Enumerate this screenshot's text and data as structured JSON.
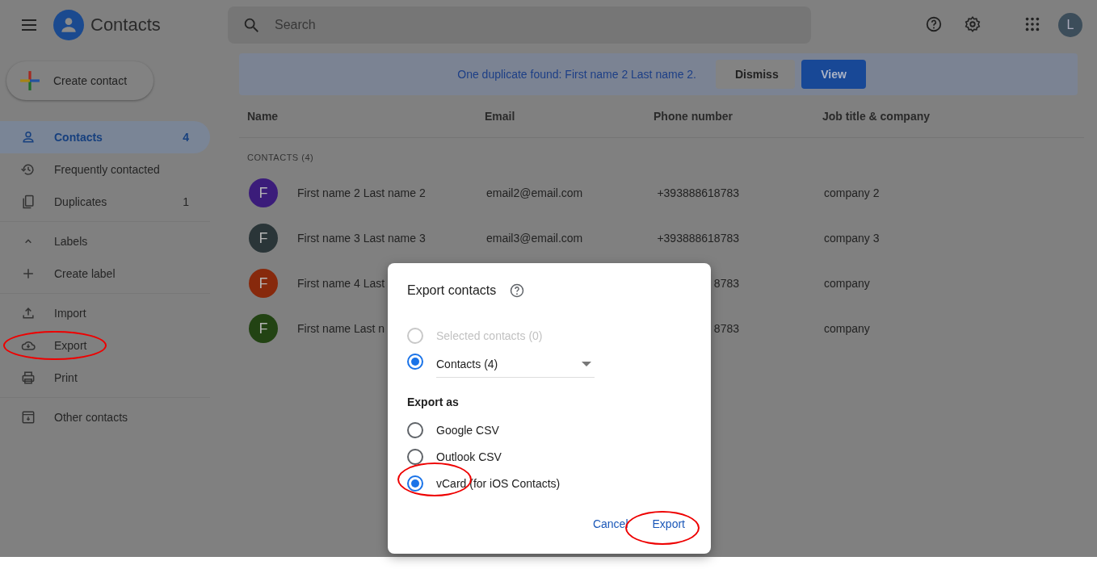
{
  "app": {
    "title": "Contacts"
  },
  "search": {
    "placeholder": "Search"
  },
  "account": {
    "initial": "L"
  },
  "sidebar": {
    "create_button": "Create contact",
    "groups": [
      {
        "items": [
          {
            "kind": "person",
            "label": "Contacts",
            "count": "4",
            "selected": true
          },
          {
            "kind": "history",
            "label": "Frequently contacted",
            "selected": false
          },
          {
            "kind": "copy",
            "label": "Duplicates",
            "count": "1",
            "selected": false
          }
        ]
      },
      {
        "items": [
          {
            "kind": "caret-up",
            "label": "Labels",
            "selected": false
          },
          {
            "kind": "plus",
            "label": "Create label",
            "selected": false
          }
        ]
      },
      {
        "items": [
          {
            "kind": "upload",
            "label": "Import",
            "selected": false
          },
          {
            "kind": "cloud-download",
            "label": "Export",
            "selected": false,
            "circled": true
          },
          {
            "kind": "print",
            "label": "Print",
            "selected": false
          }
        ]
      },
      {
        "items": [
          {
            "kind": "inbox",
            "label": "Other contacts",
            "selected": false
          }
        ]
      }
    ]
  },
  "banner": {
    "message": "One duplicate found: First name 2 Last name 2.",
    "buttons": [
      "Dismiss",
      "View"
    ]
  },
  "table": {
    "columns": [
      "Name",
      "Email",
      "Phone number",
      "Job title & company"
    ],
    "section": "CONTACTS (4)",
    "rows": [
      {
        "initial": "F",
        "color": "#3b1c7a",
        "name": "First name 2 Last name 2",
        "email": "email2@email.com",
        "phone": "+393888618783",
        "company": "company 2"
      },
      {
        "initial": "F",
        "color": "#2a3538",
        "name": "First name 3 Last name 3",
        "email": "email3@email.com",
        "phone": "+393888618783",
        "company": "company 3"
      },
      {
        "initial": "F",
        "color": "#87290c",
        "name": "First name 4 Last",
        "phone": "8783",
        "company": "company"
      },
      {
        "initial": "F",
        "color": "#224313",
        "name": "First name Last n",
        "phone": "8783",
        "company": "company"
      }
    ]
  },
  "dialog": {
    "title": "Export contacts",
    "scope": [
      {
        "label": "Selected contacts (0)",
        "selected": false,
        "disabled": true
      },
      {
        "label": "Contacts (4)",
        "selected": true,
        "disabled": false,
        "kind": "dropdown"
      }
    ],
    "format_heading": "Export as",
    "formats": [
      {
        "label": "Google CSV",
        "selected": false
      },
      {
        "label": "Outlook CSV",
        "selected": false
      },
      {
        "label": "vCard (for iOS Contacts)",
        "selected": true,
        "circled": true
      }
    ],
    "buttons": [
      {
        "label": "Cancel"
      },
      {
        "label": "Export",
        "circled": true
      }
    ]
  }
}
